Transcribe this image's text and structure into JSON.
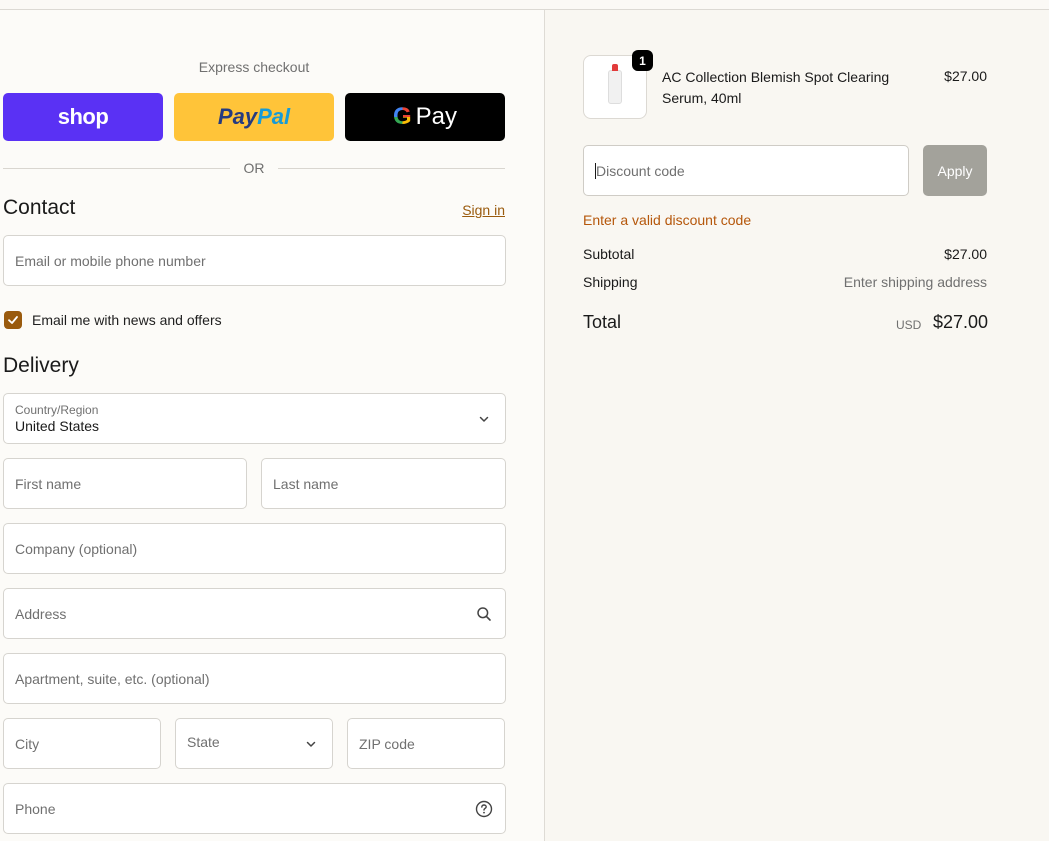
{
  "express": {
    "title": "Express checkout",
    "shop_label": "shop",
    "paypal_part1": "Pay",
    "paypal_part2": "Pal",
    "gpay_g": "G",
    "gpay_label": "Pay",
    "or_text": "OR"
  },
  "contact": {
    "heading": "Contact",
    "sign_in": "Sign in",
    "email_placeholder": "Email or mobile phone number",
    "news_checkbox_checked": true,
    "news_label": "Email me with news and offers"
  },
  "delivery": {
    "heading": "Delivery",
    "country_label": "Country/Region",
    "country_value": "United States",
    "first_name": "First name",
    "last_name": "Last name",
    "company": "Company (optional)",
    "address": "Address",
    "apartment": "Apartment, suite, etc. (optional)",
    "city": "City",
    "state": "State",
    "zip": "ZIP code",
    "phone": "Phone"
  },
  "summary": {
    "item": {
      "quantity": "1",
      "name": "AC Collection Blemish Spot Clearing Serum, 40ml",
      "price": "$27.00"
    },
    "discount_placeholder": "Discount code",
    "apply_label": "Apply",
    "discount_error": "Enter a valid discount code",
    "subtotal_label": "Subtotal",
    "subtotal_value": "$27.00",
    "shipping_label": "Shipping",
    "shipping_value": "Enter shipping address",
    "total_label": "Total",
    "total_currency": "USD",
    "total_value": "$27.00"
  },
  "colors": {
    "shop": "#5a31f4",
    "paypal": "#ffc439",
    "accent": "#9a5b0e",
    "error": "#b5570b"
  }
}
